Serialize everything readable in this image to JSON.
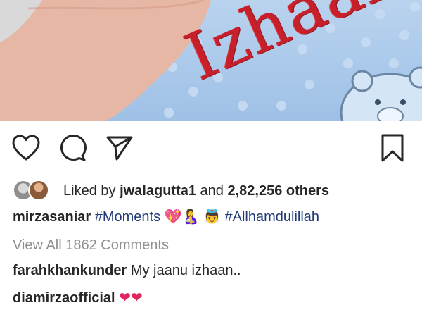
{
  "post": {
    "image_text": "Izhaan",
    "liked_by_prefix": "Liked by",
    "liked_by_user": "jwalagutta1",
    "and_text": "and",
    "others_count": "2,82,256 others",
    "caption": {
      "username": "mirzasaniar",
      "hashtag_1": "#Moments",
      "emoji_1": "💖",
      "emoji_2": "🤱",
      "emoji_3": "👼",
      "hashtag_2": "#Allhamdulillah"
    },
    "view_comments": "View All 1862 Comments",
    "comments": [
      {
        "username": "farahkhankunder",
        "text": "My jaanu izhaan.."
      },
      {
        "username": "diamirzaofficial",
        "text": "❤❤"
      }
    ]
  },
  "icons": {
    "like": "heart-outline",
    "comment": "speech-bubble",
    "share": "paper-plane",
    "save": "bookmark-outline"
  },
  "colors": {
    "text": "#262626",
    "hashtag": "#1f3a77",
    "muted": "#8e8e8e",
    "heart": "#e0245e",
    "blanket": "#a9c8ea",
    "embroidery": "#c8202a"
  }
}
